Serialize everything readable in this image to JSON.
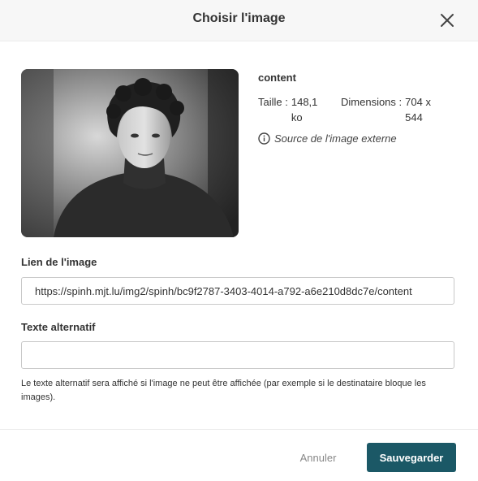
{
  "dialog": {
    "title": "Choisir l'image",
    "close_icon": "close-icon"
  },
  "image": {
    "name": "content",
    "size_label": "Taille :",
    "size_value": "148,1 ko",
    "dimensions_label": "Dimensions :",
    "dimensions_value": "704 x 544",
    "source_icon": "info-icon",
    "source_text": "Source de l'image externe",
    "preview_description": "black-and-white portrait photo"
  },
  "link": {
    "label": "Lien de l'image",
    "value": "https://spinh.mjt.lu/img2/spinh/bc9f2787-3403-4014-a792-a6e210d8dc7e/content"
  },
  "alt": {
    "label": "Texte alternatif",
    "value": "",
    "help": "Le texte alternatif sera affiché si l'image ne peut être affichée (par exemple si le destinataire bloque les images)."
  },
  "footer": {
    "cancel_label": "Annuler",
    "save_label": "Sauvegarder"
  },
  "colors": {
    "primary": "#1b5866",
    "header_bg": "#f7f7f7"
  }
}
